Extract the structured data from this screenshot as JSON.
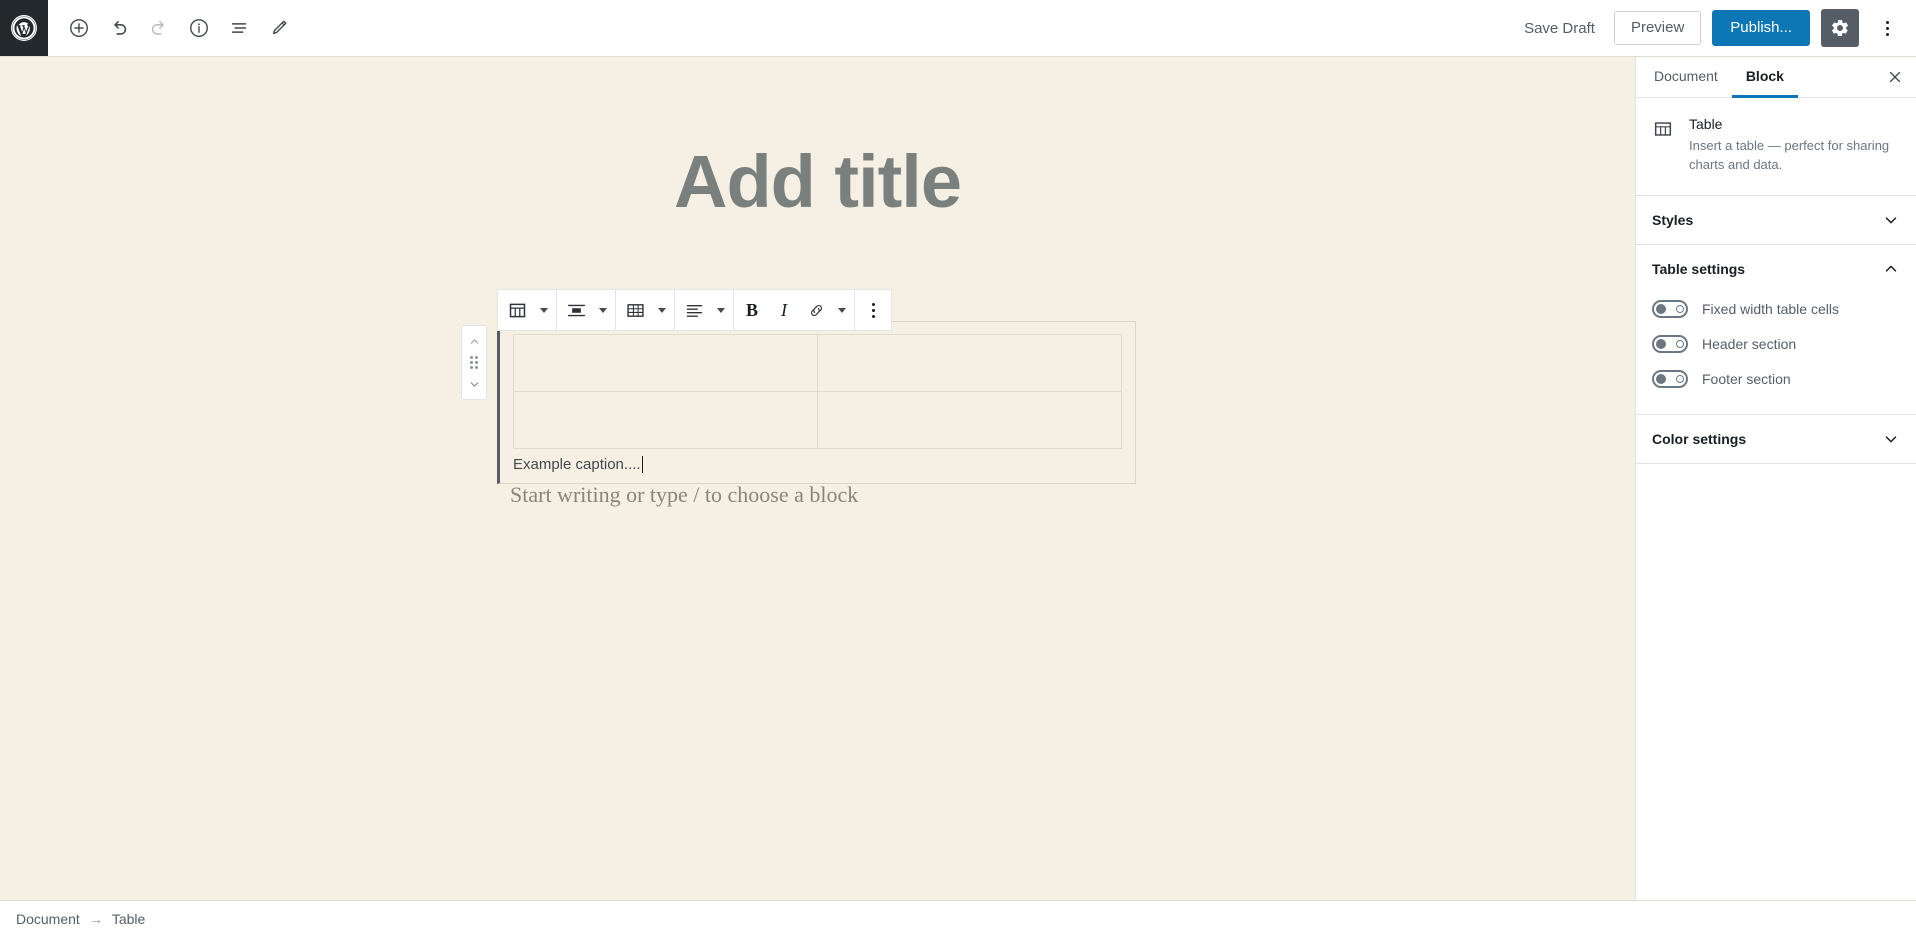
{
  "topbar": {
    "logo_icon": "wordpress-logo-icon",
    "tools": [
      {
        "icon": "add-block-icon",
        "name": "add-block-button",
        "disabled": false
      },
      {
        "icon": "undo-icon",
        "name": "undo-button",
        "disabled": false
      },
      {
        "icon": "redo-icon",
        "name": "redo-button",
        "disabled": true
      },
      {
        "icon": "info-icon",
        "name": "content-structure-button",
        "disabled": false
      },
      {
        "icon": "list-view-icon",
        "name": "block-navigation-button",
        "disabled": false
      },
      {
        "icon": "pencil-icon",
        "name": "edit-mode-button",
        "disabled": false
      }
    ],
    "save_draft_label": "Save Draft",
    "preview_label": "Preview",
    "publish_label": "Publish...",
    "settings_icon": "gear-icon",
    "more_icon": "vertical-ellipsis-icon",
    "publish_color": "#0d76b4"
  },
  "editor": {
    "title_placeholder": "Add title",
    "paragraph_placeholder": "Start writing or type / to choose a block",
    "canvas_color": "#f6f0e4"
  },
  "block_toolbar": {
    "groups": [
      {
        "name": "block-type-group",
        "buttons": [
          {
            "icon": "table-block-icon",
            "name": "change-block-type-button",
            "has_caret": true
          }
        ]
      },
      {
        "name": "block-align-group",
        "buttons": [
          {
            "icon": "align-center-block-icon",
            "name": "change-block-alignment-button",
            "has_caret": true
          }
        ]
      },
      {
        "name": "edit-table-group",
        "buttons": [
          {
            "icon": "edit-table-icon",
            "name": "edit-table-button",
            "has_caret": true
          }
        ]
      },
      {
        "name": "text-align-group",
        "buttons": [
          {
            "icon": "align-text-left-icon",
            "name": "change-text-alignment-button",
            "has_caret": true
          }
        ]
      },
      {
        "name": "formatting-group",
        "buttons": [
          {
            "icon": "bold-icon",
            "name": "bold-button",
            "label": "B",
            "has_caret": false
          },
          {
            "icon": "italic-icon",
            "name": "italic-button",
            "label": "I",
            "has_caret": false
          },
          {
            "icon": "link-icon",
            "name": "link-button",
            "has_caret": false
          },
          {
            "icon": "chevron-down-icon",
            "name": "more-rich-text-controls-button",
            "has_caret": true
          }
        ]
      },
      {
        "name": "block-options-group",
        "buttons": [
          {
            "icon": "vertical-ellipsis-icon",
            "name": "block-options-button",
            "has_caret": false
          }
        ]
      }
    ]
  },
  "block_mover": {
    "up_icon": "chevron-up-icon",
    "drag_icon": "drag-handle-icon",
    "down_icon": "chevron-down-icon"
  },
  "table_block": {
    "rows": [
      [
        "",
        ""
      ],
      [
        "",
        ""
      ]
    ],
    "caption": "Example caption....",
    "selected_accent": "#555d66"
  },
  "sidebar": {
    "tabs": [
      {
        "label": "Document",
        "name": "tab-document",
        "active": false
      },
      {
        "label": "Block",
        "name": "tab-block",
        "active": true
      }
    ],
    "close_icon": "close-icon",
    "active_tab_color": "#0d76b4",
    "block_card": {
      "icon": "table-block-icon",
      "title": "Table",
      "description": "Insert a table — perfect for sharing charts and data."
    },
    "panels": [
      {
        "title": "Styles",
        "name": "panel-styles",
        "expanded": false,
        "chevron": "chevron-down-icon"
      },
      {
        "title": "Table settings",
        "name": "panel-table-settings",
        "expanded": true,
        "chevron": "chevron-up-icon",
        "toggles": [
          {
            "label": "Fixed width table cells",
            "name": "toggle-fixed-width-table-cells",
            "on": false
          },
          {
            "label": "Header section",
            "name": "toggle-header-section",
            "on": false
          },
          {
            "label": "Footer section",
            "name": "toggle-footer-section",
            "on": false
          }
        ]
      },
      {
        "title": "Color settings",
        "name": "panel-color-settings",
        "expanded": false,
        "chevron": "chevron-down-icon"
      }
    ]
  },
  "breadcrumb": {
    "root": "Document",
    "separator": "→",
    "current": "Table"
  }
}
